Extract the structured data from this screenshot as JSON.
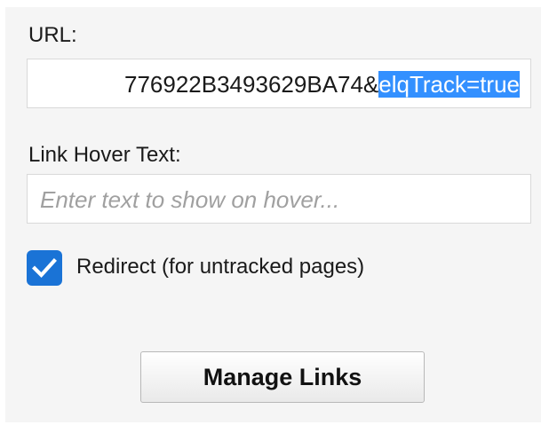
{
  "url": {
    "label": "URL:",
    "value_unselected": "776922B3493629BA74&",
    "value_selected": "elqTrack=true"
  },
  "hover": {
    "label": "Link Hover Text:",
    "placeholder": "Enter text to show on hover..."
  },
  "redirect": {
    "label": "Redirect (for untracked pages)",
    "checked": true
  },
  "manage_links": {
    "label": "Manage Links"
  },
  "colors": {
    "checkbox": "#1a73d6",
    "selection": "#3390ff",
    "panel": "#f5f5f5"
  },
  "icons": {
    "checkbox": "checkmark-icon"
  }
}
